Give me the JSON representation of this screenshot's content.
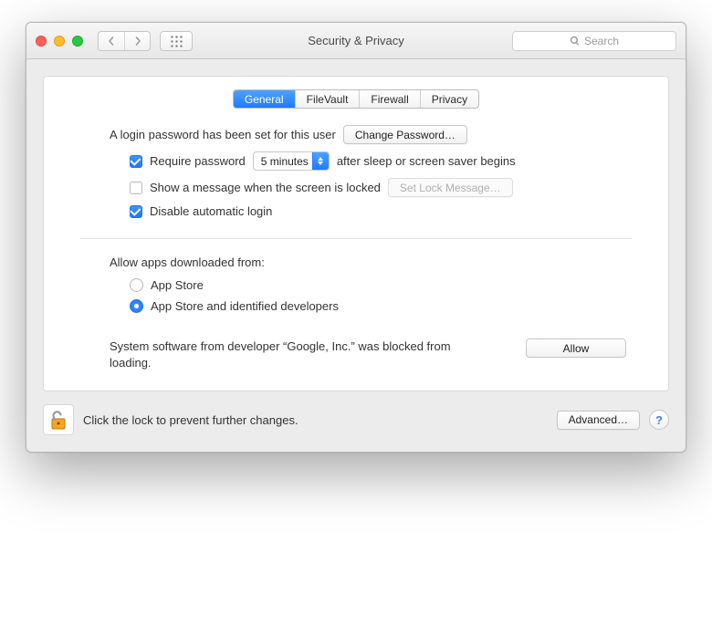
{
  "window": {
    "title": "Security & Privacy"
  },
  "toolbar": {
    "search_placeholder": "Search"
  },
  "tabs": [
    {
      "label": "General",
      "active": true
    },
    {
      "label": "FileVault",
      "active": false
    },
    {
      "label": "Firewall",
      "active": false
    },
    {
      "label": "Privacy",
      "active": false
    }
  ],
  "login": {
    "password_set_text": "A login password has been set for this user",
    "change_password_label": "Change Password…",
    "require_password_checked": true,
    "require_password_label": "Require password",
    "require_password_delay": "5 minutes",
    "require_password_suffix": "after sleep or screen saver begins",
    "show_message_checked": false,
    "show_message_label": "Show a message when the screen is locked",
    "set_lock_message_label": "Set Lock Message…",
    "set_lock_message_enabled": false,
    "disable_auto_login_checked": true,
    "disable_auto_login_label": "Disable automatic login"
  },
  "gatekeeper": {
    "heading": "Allow apps downloaded from:",
    "options": [
      {
        "label": "App Store",
        "selected": false
      },
      {
        "label": "App Store and identified developers",
        "selected": true
      }
    ],
    "blocked_text": "System software from developer “Google, Inc.” was blocked from loading.",
    "allow_label": "Allow"
  },
  "footer": {
    "lock_text": "Click the lock to prevent further changes.",
    "advanced_label": "Advanced…"
  }
}
